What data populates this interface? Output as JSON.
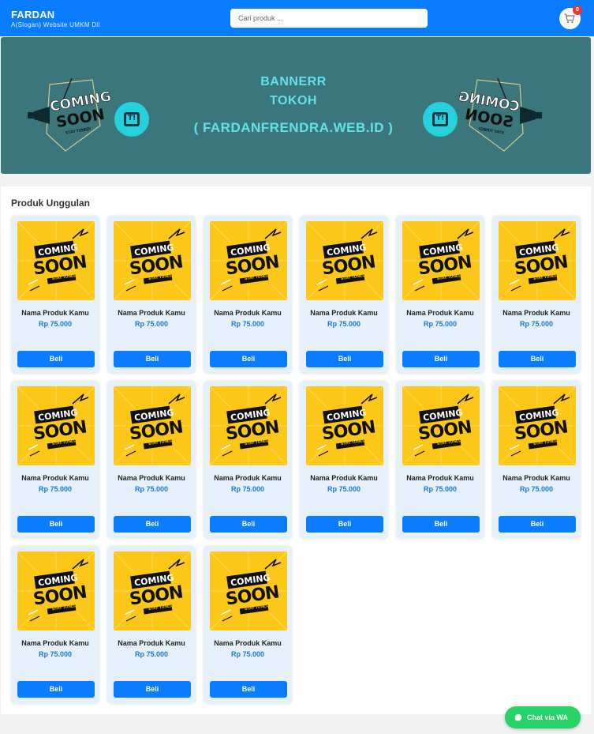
{
  "header": {
    "brand_title": "FARDAN",
    "brand_slogan": "A(Slogan) Website UMKM Dll",
    "search_placeholder": "Cari produk ...",
    "cart_count": "0",
    "accent_color": "#0a7cff"
  },
  "banner": {
    "line1": "BANNERR",
    "line2": "TOKOH",
    "line3": "( FARDANFRENDRA.WEB.ID )",
    "badge_text_top": "COMING",
    "badge_text_bottom": "SOON",
    "badge_tagline": "STAY TUNED!",
    "icon_text": "T!",
    "bg_color": "#3b767c",
    "text_color": "#63e1e8"
  },
  "section": {
    "title": "Produk Unggulan"
  },
  "product_image": {
    "text_top": "COMING",
    "text_bottom": "SOON",
    "tagline": "STAY TUNED!",
    "bg_color": "#fdc71a"
  },
  "products": [
    {
      "name": "Nama Produk Kamu",
      "price": "Rp 75.000",
      "button": "Beli"
    },
    {
      "name": "Nama Produk Kamu",
      "price": "Rp 75.000",
      "button": "Beli"
    },
    {
      "name": "Nama Produk Kamu",
      "price": "Rp 75.000",
      "button": "Beli"
    },
    {
      "name": "Nama Produk Kamu",
      "price": "Rp 75.000",
      "button": "Beli"
    },
    {
      "name": "Nama Produk Kamu",
      "price": "Rp 75.000",
      "button": "Beli"
    },
    {
      "name": "Nama Produk Kamu",
      "price": "Rp 75.000",
      "button": "Beli"
    },
    {
      "name": "Nama Produk Kamu",
      "price": "Rp 75.000",
      "button": "Beli"
    },
    {
      "name": "Nama Produk Kamu",
      "price": "Rp 75.000",
      "button": "Beli"
    },
    {
      "name": "Nama Produk Kamu",
      "price": "Rp 75.000",
      "button": "Beli"
    },
    {
      "name": "Nama Produk Kamu",
      "price": "Rp 75.000",
      "button": "Beli"
    },
    {
      "name": "Nama Produk Kamu",
      "price": "Rp 75.000",
      "button": "Beli"
    },
    {
      "name": "Nama Produk Kamu",
      "price": "Rp 75.000",
      "button": "Beli"
    },
    {
      "name": "Nama Produk Kamu",
      "price": "Rp 75.000",
      "button": "Beli"
    },
    {
      "name": "Nama Produk Kamu",
      "price": "Rp 75.000",
      "button": "Beli"
    },
    {
      "name": "Nama Produk Kamu",
      "price": "Rp 75.000",
      "button": "Beli"
    }
  ],
  "whatsapp": {
    "label": "Chat via WA",
    "icon": "whatsapp-icon",
    "color": "#25d366"
  }
}
